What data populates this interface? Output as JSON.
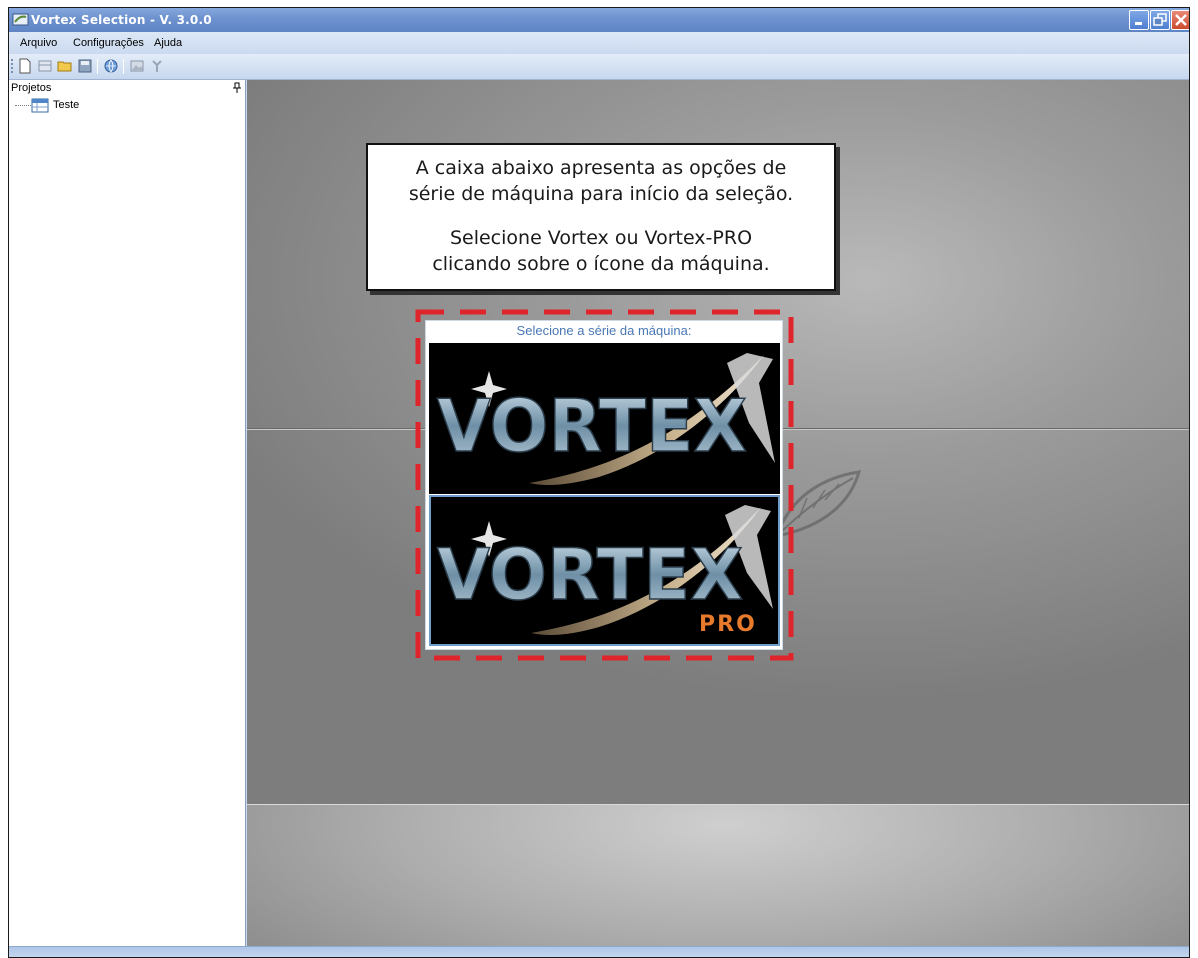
{
  "window": {
    "title": "Vortex Selection - V. 3.0.0",
    "controls": {
      "minimize_icon": "minimize-icon",
      "restore_icon": "restore-icon",
      "close_icon": "close-icon"
    }
  },
  "menu": {
    "items": [
      {
        "label": "Arquivo"
      },
      {
        "label": "Configurações"
      },
      {
        "label": "Ajuda"
      }
    ]
  },
  "toolbar": {
    "buttons": [
      {
        "icon": "new-document-icon"
      },
      {
        "icon": "new-item-icon"
      },
      {
        "icon": "open-folder-icon"
      },
      {
        "icon": "save-icon"
      },
      {
        "icon": "globe-icon"
      },
      {
        "icon": "image-icon"
      },
      {
        "icon": "settings-icon"
      }
    ]
  },
  "projects": {
    "header": "Projetos",
    "pin_icon": "pin-icon",
    "items": [
      {
        "label": "Teste",
        "icon": "project-table-icon"
      }
    ]
  },
  "callout": {
    "paragraph1": [
      "A caixa abaixo apresenta as opções de",
      "série de máquina para início da seleção."
    ],
    "paragraph2": [
      "Selecione Vortex ou Vortex-PRO",
      "clicando sobre o ícone da máquina."
    ]
  },
  "series_selector": {
    "title": "Selecione a série da máquina:",
    "options": [
      {
        "logo_text": "VORTEX",
        "badge": ""
      },
      {
        "logo_text": "VORTEX",
        "badge": "PRO"
      }
    ]
  },
  "colors": {
    "titlebar": "#6f93cf",
    "highlight_dash": "#e0242b",
    "dialog_title": "#4a78b4",
    "pro_badge": "#e87a2c"
  }
}
